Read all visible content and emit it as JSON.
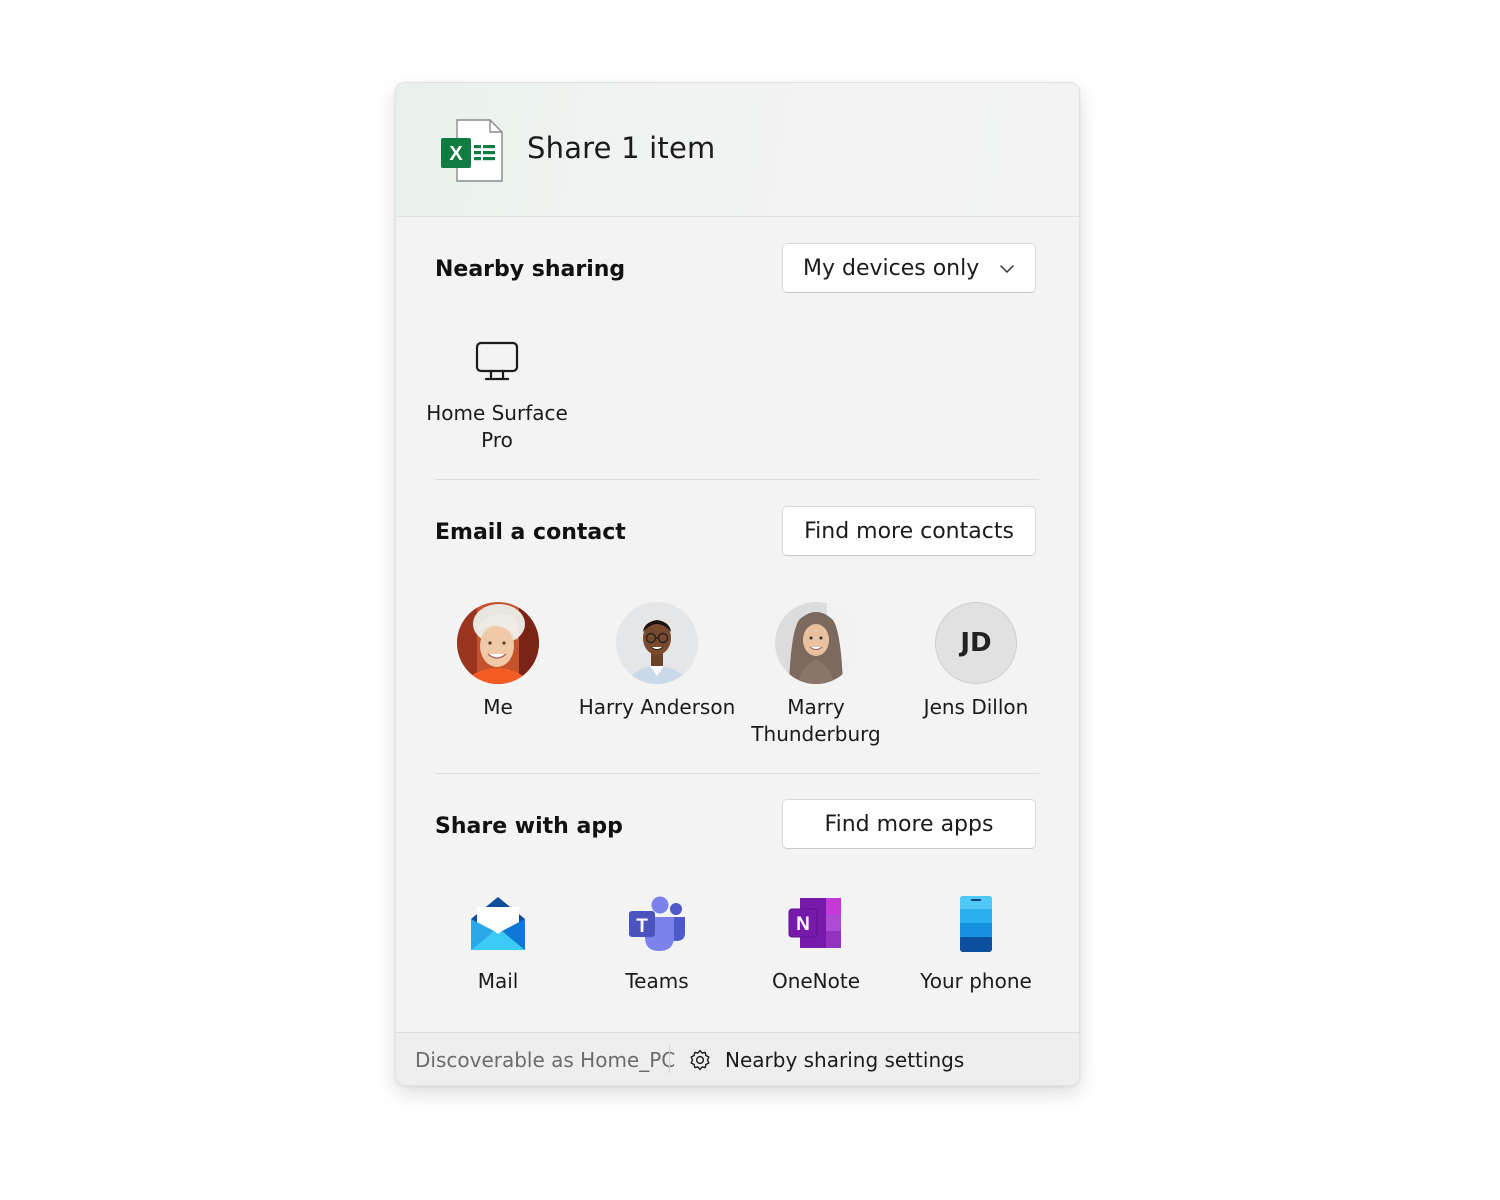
{
  "header": {
    "title": "Share 1 item",
    "file_icon": "excel-file-icon"
  },
  "nearby": {
    "title": "Nearby sharing",
    "dropdown_value": "My devices only",
    "devices": [
      {
        "line1": "Home Surface",
        "line2": "Pro",
        "icon": "monitor-icon"
      }
    ]
  },
  "email": {
    "title": "Email a contact",
    "button": "Find more contacts",
    "contacts": [
      {
        "line1": "Me",
        "line2": ""
      },
      {
        "line1": "Harry Anderson",
        "line2": ""
      },
      {
        "line1": "Marry",
        "line2": "Thunderburg"
      },
      {
        "line1": "Jens Dillon",
        "line2": "",
        "initials": "JD"
      }
    ]
  },
  "apps": {
    "title": "Share with app",
    "button": "Find more apps",
    "items": [
      {
        "name": "Mail",
        "icon": "mail-icon"
      },
      {
        "name": "Teams",
        "icon": "teams-icon"
      },
      {
        "name": "OneNote",
        "icon": "onenote-icon"
      },
      {
        "name": "Your phone",
        "icon": "your-phone-icon"
      }
    ]
  },
  "footer": {
    "discoverable": "Discoverable as Home_PC",
    "settings_label": "Nearby sharing settings"
  },
  "colors": {
    "excel_green": "#107c41",
    "teams_purple": "#5059c9",
    "onenote_purple": "#7719aa",
    "mail_blue": "#0f78d4",
    "phone_blue": "#1490df"
  }
}
